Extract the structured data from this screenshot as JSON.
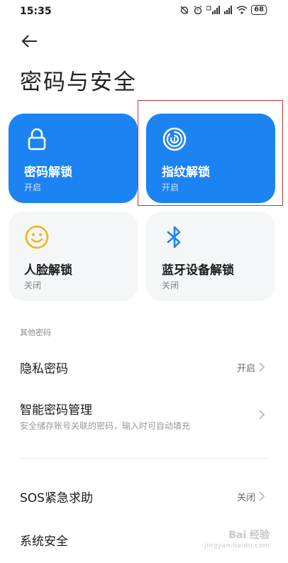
{
  "status_bar": {
    "time": "15:35",
    "battery": "68"
  },
  "header": {
    "title": "密码与安全"
  },
  "tiles": [
    {
      "label": "密码解锁",
      "status": "开启"
    },
    {
      "label": "指纹解锁",
      "status": "开启"
    },
    {
      "label": "人脸解锁",
      "status": "关闭"
    },
    {
      "label": "蓝牙设备解锁",
      "status": "关闭"
    }
  ],
  "section_other": {
    "header": "其他密码"
  },
  "rows": {
    "privacy": {
      "title": "隐私密码",
      "value": "开启"
    },
    "smart": {
      "title": "智能密码管理",
      "subtitle": "安全储存账号关联的密码，输入时可自动填充"
    },
    "sos": {
      "title": "SOS紧急求助",
      "value": "关闭"
    },
    "system": {
      "title": "系统安全"
    }
  },
  "watermark": {
    "text": "Bai 经验",
    "sub": "jingyan.baidu.com"
  },
  "colors": {
    "accent": "#1b83f2",
    "tile_inactive": "#f5f6f7",
    "highlight": "#d0312d",
    "face_icon": "#f2b418"
  }
}
